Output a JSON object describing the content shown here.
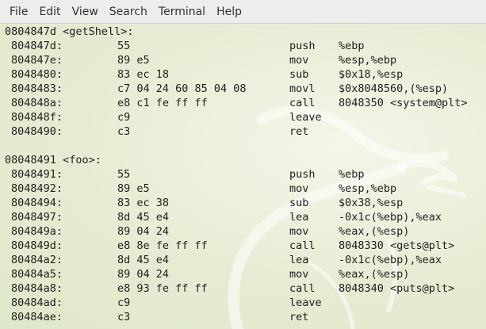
{
  "menu": [
    "File",
    "Edit",
    "View",
    "Search",
    "Terminal",
    "Help"
  ],
  "blocks": [
    {
      "header": "0804847d <getShell>:",
      "rows": [
        {
          "addr": "804847d:",
          "hex": "55",
          "mn": "push",
          "op": "%ebp"
        },
        {
          "addr": "804847e:",
          "hex": "89 e5",
          "mn": "mov",
          "op": "%esp,%ebp"
        },
        {
          "addr": "8048480:",
          "hex": "83 ec 18",
          "mn": "sub",
          "op": "$0x18,%esp"
        },
        {
          "addr": "8048483:",
          "hex": "c7 04 24 60 85 04 08",
          "mn": "movl",
          "op": "$0x8048560,(%esp)"
        },
        {
          "addr": "804848a:",
          "hex": "e8 c1 fe ff ff",
          "mn": "call",
          "op": "8048350 <system@plt>"
        },
        {
          "addr": "804848f:",
          "hex": "c9",
          "mn": "leave",
          "op": ""
        },
        {
          "addr": "8048490:",
          "hex": "c3",
          "mn": "ret",
          "op": ""
        }
      ]
    },
    {
      "header": "08048491 <foo>:",
      "rows": [
        {
          "addr": "8048491:",
          "hex": "55",
          "mn": "push",
          "op": "%ebp"
        },
        {
          "addr": "8048492:",
          "hex": "89 e5",
          "mn": "mov",
          "op": "%esp,%ebp"
        },
        {
          "addr": "8048494:",
          "hex": "83 ec 38",
          "mn": "sub",
          "op": "$0x38,%esp"
        },
        {
          "addr": "8048497:",
          "hex": "8d 45 e4",
          "mn": "lea",
          "op": "-0x1c(%ebp),%eax"
        },
        {
          "addr": "804849a:",
          "hex": "89 04 24",
          "mn": "mov",
          "op": "%eax,(%esp)"
        },
        {
          "addr": "804849d:",
          "hex": "e8 8e fe ff ff",
          "mn": "call",
          "op": "8048330 <gets@plt>"
        },
        {
          "addr": "80484a2:",
          "hex": "8d 45 e4",
          "mn": "lea",
          "op": "-0x1c(%ebp),%eax"
        },
        {
          "addr": "80484a5:",
          "hex": "89 04 24",
          "mn": "mov",
          "op": "%eax,(%esp)"
        },
        {
          "addr": "80484a8:",
          "hex": "e8 93 fe ff ff",
          "mn": "call",
          "op": "8048340 <puts@plt>"
        },
        {
          "addr": "80484ad:",
          "hex": "c9",
          "mn": "leave",
          "op": ""
        },
        {
          "addr": "80484ae:",
          "hex": "c3",
          "mn": "ret",
          "op": ""
        }
      ]
    }
  ],
  "background_icon": "kali-dragon-watermark",
  "colors": {
    "menubar": "#ededeb",
    "terminal_bg": "#e9eed9",
    "text": "#1e1e1e"
  }
}
